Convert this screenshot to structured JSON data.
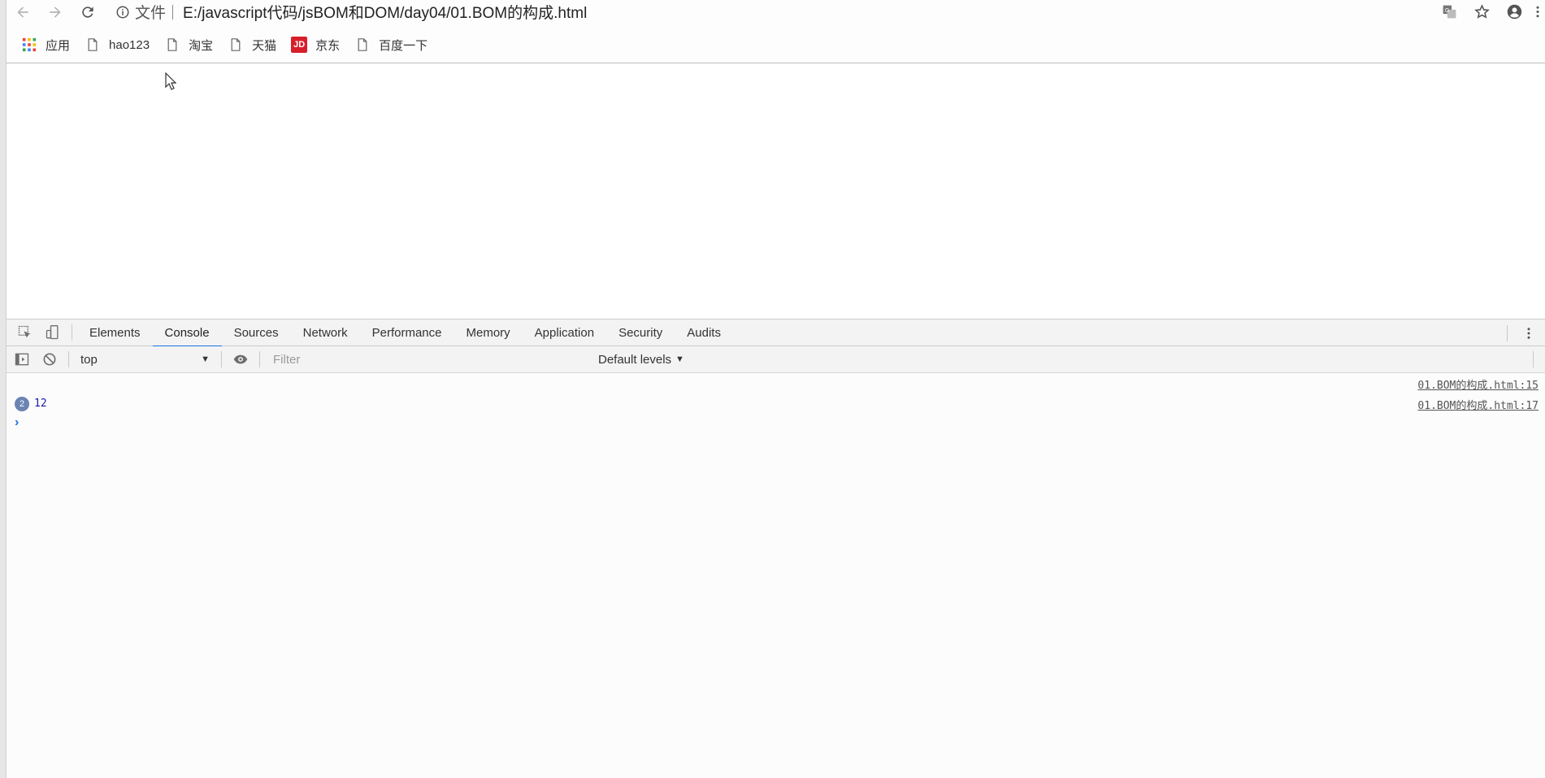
{
  "browser": {
    "scheme_label": "文件",
    "url": "E:/javascript代码/jsBOM和DOM/day04/01.BOM的构成.html",
    "icons": {
      "back": "back-arrow-icon",
      "forward": "forward-arrow-icon",
      "reload": "reload-icon",
      "info": "info-icon",
      "translate": "translate-icon",
      "star": "star-icon",
      "profile": "profile-icon",
      "menu": "menu-icon"
    }
  },
  "bookmarks": [
    {
      "label": "应用",
      "icon": "apps-grid-icon"
    },
    {
      "label": "hao123",
      "icon": "page-icon"
    },
    {
      "label": "淘宝",
      "icon": "page-icon"
    },
    {
      "label": "天猫",
      "icon": "page-icon"
    },
    {
      "label": "京东",
      "icon": "jd-logo-icon",
      "icon_text": "JD"
    },
    {
      "label": "百度一下",
      "icon": "page-icon"
    }
  ],
  "devtools": {
    "tabs": [
      {
        "label": "Elements",
        "active": false
      },
      {
        "label": "Console",
        "active": true
      },
      {
        "label": "Sources",
        "active": false
      },
      {
        "label": "Network",
        "active": false
      },
      {
        "label": "Performance",
        "active": false
      },
      {
        "label": "Memory",
        "active": false
      },
      {
        "label": "Application",
        "active": false
      },
      {
        "label": "Security",
        "active": false
      },
      {
        "label": "Audits",
        "active": false
      }
    ],
    "console_toolbar": {
      "context": "top",
      "filter_placeholder": "Filter",
      "levels": "Default levels"
    },
    "messages": [
      {
        "text": "",
        "source": "01.BOM的构成.html:15",
        "count": null
      },
      {
        "text": "12",
        "source": "01.BOM的构成.html:17",
        "count": "2"
      }
    ],
    "prompt": "›"
  },
  "colors": {
    "accent": "#1a73e8",
    "repeat_badge": "#6b84b4",
    "jd_red": "#d71f2b",
    "value_blue": "#1a1aa6"
  }
}
